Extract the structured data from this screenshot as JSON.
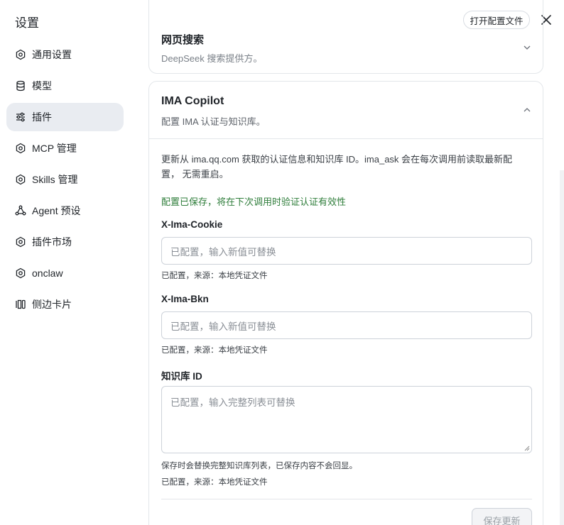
{
  "window": {
    "title": "设置",
    "open_config_label": "打开配置文件",
    "close_icon": "close-icon"
  },
  "sidebar": {
    "items": [
      {
        "label": "通用设置",
        "icon": "gear-icon",
        "active": false
      },
      {
        "label": "模型",
        "icon": "database-icon",
        "active": false
      },
      {
        "label": "插件",
        "icon": "sliders-icon",
        "active": true
      },
      {
        "label": "MCP 管理",
        "icon": "gear-icon",
        "active": false
      },
      {
        "label": "Skills 管理",
        "icon": "gear-icon",
        "active": false
      },
      {
        "label": "Agent 预设",
        "icon": "agent-icon",
        "active": false
      },
      {
        "label": "插件市场",
        "icon": "gear-icon",
        "active": false
      },
      {
        "label": "onclaw",
        "icon": "gear-icon",
        "active": false
      },
      {
        "label": "侧边卡片",
        "icon": "side-card-icon",
        "active": false
      }
    ]
  },
  "web_search": {
    "title": "网页搜索",
    "subtitle": "DeepSeek 搜索提供方。"
  },
  "ima": {
    "title": "IMA Copilot",
    "subtitle": "配置 IMA 认证与知识库。",
    "description": "更新从 ima.qq.com 获取的认证信息和知识库 ID。ima_ask 会在每次调用前读取最新配置， 无需重启。",
    "saved_message": "配置已保存，将在下次调用时验证认证有效性",
    "cookie": {
      "label": "X-Ima-Cookie",
      "placeholder": "已配置，输入新值可替换",
      "hint": "已配置，来源：本地凭证文件"
    },
    "bkn": {
      "label": "X-Ima-Bkn",
      "placeholder": "已配置，输入新值可替换",
      "hint": "已配置，来源：本地凭证文件"
    },
    "kb": {
      "label": "知识库 ID",
      "placeholder": "已配置，输入完整列表可替换",
      "note": "保存时会替换完整知识库列表，已保存内容不会回显。",
      "hint": "已配置，来源：本地凭证文件"
    },
    "save_label": "保存更新"
  },
  "colors": {
    "active_bg": "#e9ecf1",
    "success_text": "#2e7d3a",
    "border": "#e3e6ea"
  }
}
